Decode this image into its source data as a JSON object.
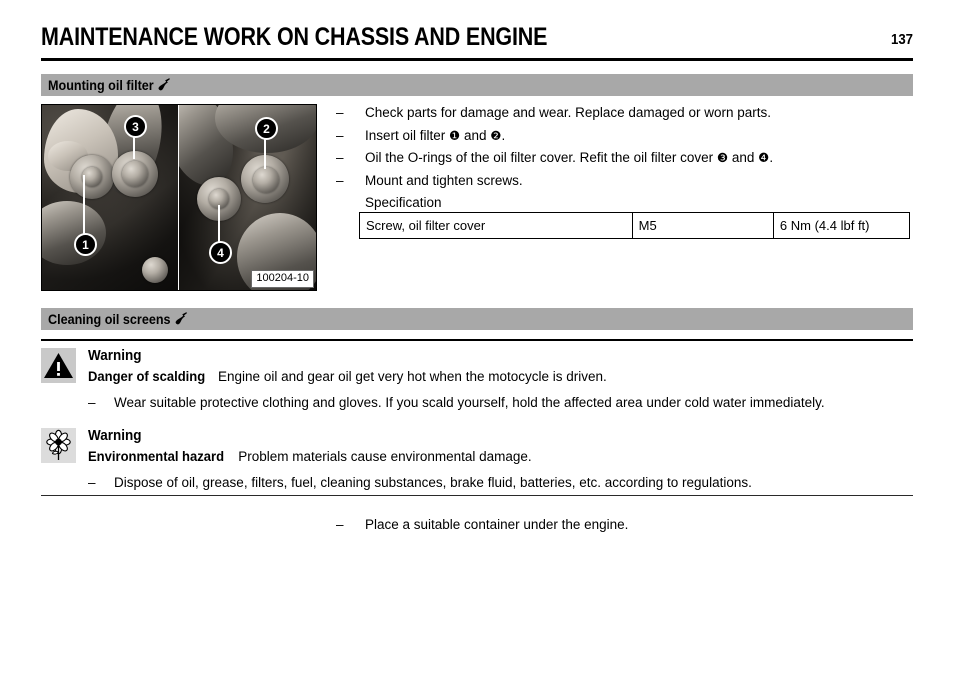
{
  "header": {
    "title": "MAINTENANCE WORK ON CHASSIS AND ENGINE",
    "page_number": "137"
  },
  "sections": [
    {
      "id": "mounting-oil-filter",
      "title": "Mounting oil filter",
      "icon": "wrench-icon",
      "figure": {
        "caption": "100204-10",
        "callouts": [
          "1",
          "3",
          "2",
          "4"
        ]
      },
      "steps": [
        {
          "dash": "–",
          "text": "Check parts for damage and wear. Replace damaged or worn parts."
        },
        {
          "dash": "–",
          "text_before": "Insert oil filter ",
          "marker_a": "❶",
          "text_mid": " and ",
          "marker_b": "❷",
          "text_after": "."
        },
        {
          "dash": "–",
          "text_before": "Oil the O-rings of the oil filter cover. Refit the oil filter cover ",
          "marker_a": "❸",
          "text_mid": " and ",
          "marker_b": "❹",
          "text_after": "."
        },
        {
          "dash": "–",
          "text": "Mount and tighten screws."
        },
        {
          "dash": "",
          "text": "Specification"
        }
      ],
      "spec_table": {
        "rows": [
          {
            "name": "Screw, oil filter cover",
            "size": "M5",
            "torque": "6 Nm (4.4 lbf ft)"
          }
        ]
      }
    },
    {
      "id": "cleaning-oil-screens",
      "title": "Cleaning oil screens",
      "icon": "wrench-icon",
      "warnings": [
        {
          "icon": "warning-triangle-icon",
          "title": "Warning",
          "subject": "Danger of scalding",
          "text": "Engine oil and gear oil get very hot when the motocycle is driven.",
          "steps": [
            {
              "dash": "–",
              "text": "Wear suitable protective clothing and gloves. If you scald yourself, hold the affected area under cold water immediately."
            }
          ]
        },
        {
          "icon": "environment-flower-icon",
          "title": "Warning",
          "subject": "Environmental hazard",
          "text": "Problem materials cause environmental damage.",
          "steps": [
            {
              "dash": "–",
              "text": "Dispose of oil, grease, filters, fuel, cleaning substances, brake fluid, batteries, etc. according to regulations."
            }
          ]
        }
      ],
      "steps": [
        {
          "dash": "–",
          "text": "Place a suitable container under the engine."
        }
      ]
    }
  ],
  "colors": {
    "section_bar": "#a8a8a8",
    "warning_icon_bg": "#c9c9c9",
    "env_icon_bg": "#dcdcdc"
  }
}
